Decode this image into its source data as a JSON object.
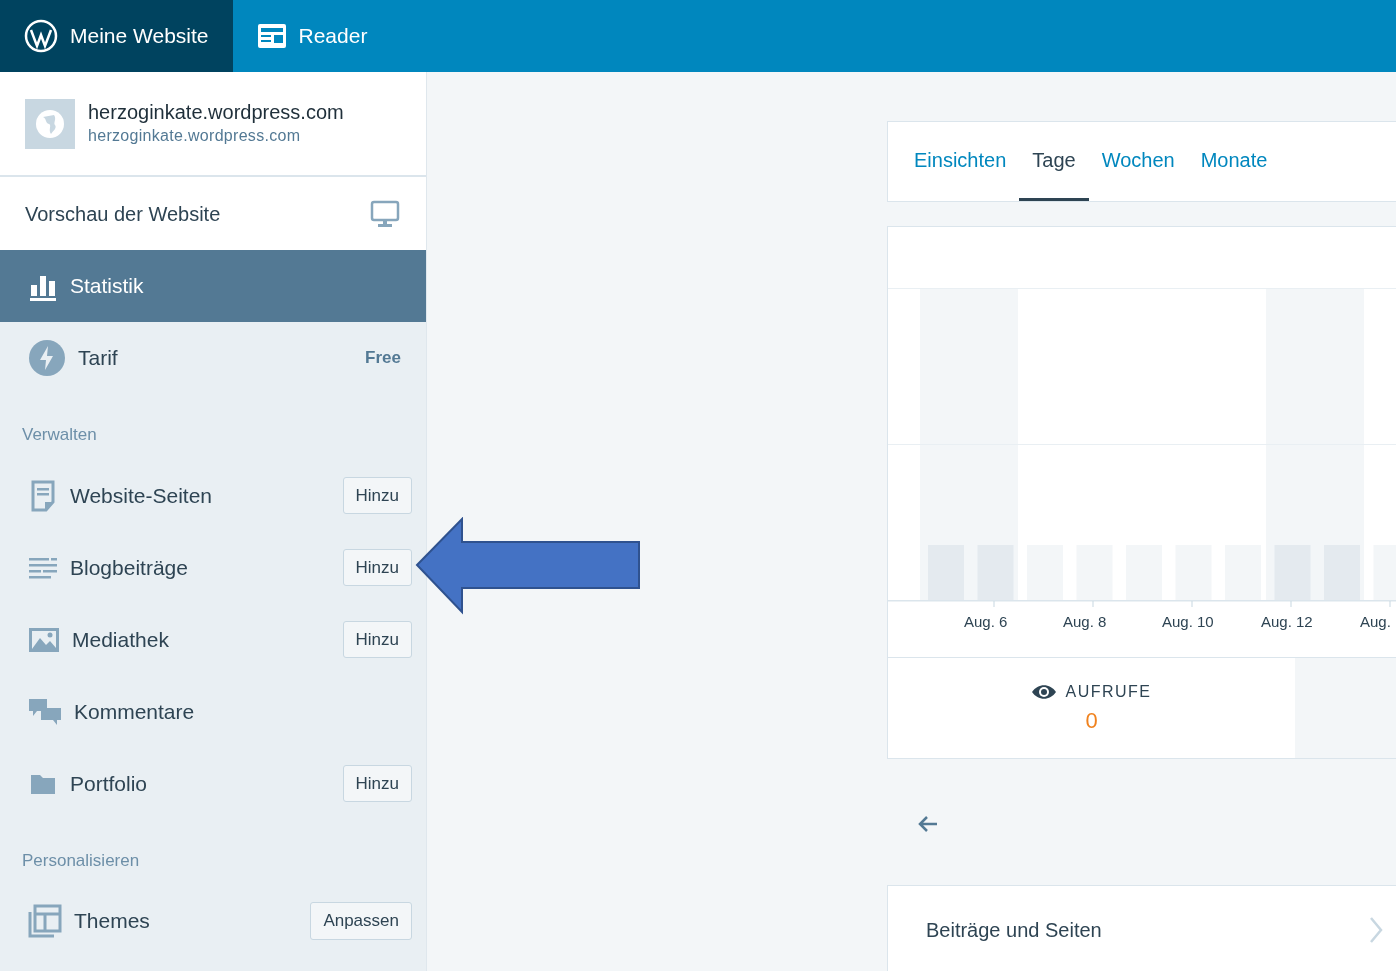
{
  "masterbar": [
    {
      "label": "Meine Website",
      "selected": true
    },
    {
      "label": "Reader",
      "selected": false
    }
  ],
  "site": {
    "title": "herzoginkate.wordpress.com",
    "url": "herzoginkate.wordpress.com"
  },
  "preview": {
    "label": "Vorschau der Website"
  },
  "menu": [
    {
      "label": "Statistik",
      "selected": true
    },
    {
      "label": "Tarif",
      "selected": false,
      "badge": "Free"
    }
  ],
  "sections": [
    {
      "heading": "Verwalten",
      "items": [
        {
          "label": "Website-Seiten",
          "button": "Hinzu"
        },
        {
          "label": "Blogbeiträge",
          "button": "Hinzu"
        },
        {
          "label": "Mediathek",
          "button": "Hinzu"
        },
        {
          "label": "Kommentare"
        },
        {
          "label": "Portfolio",
          "button": "Hinzu"
        }
      ]
    },
    {
      "heading": "Personalisieren",
      "items": [
        {
          "label": "Themes",
          "button": "Anpassen"
        }
      ]
    }
  ],
  "period_tabs": [
    {
      "label": "Einsichten",
      "selected": false
    },
    {
      "label": "Tage",
      "selected": true
    },
    {
      "label": "Wochen",
      "selected": false
    },
    {
      "label": "Monate",
      "selected": false
    }
  ],
  "chart": {
    "x_labels": [
      "Aug. 6",
      "Aug. 8",
      "Aug. 10",
      "Aug. 12",
      "Aug."
    ]
  },
  "summary": {
    "label": "AUFRUFE",
    "value": "0"
  },
  "section_link": {
    "label": "Beiträge und Seiten"
  }
}
